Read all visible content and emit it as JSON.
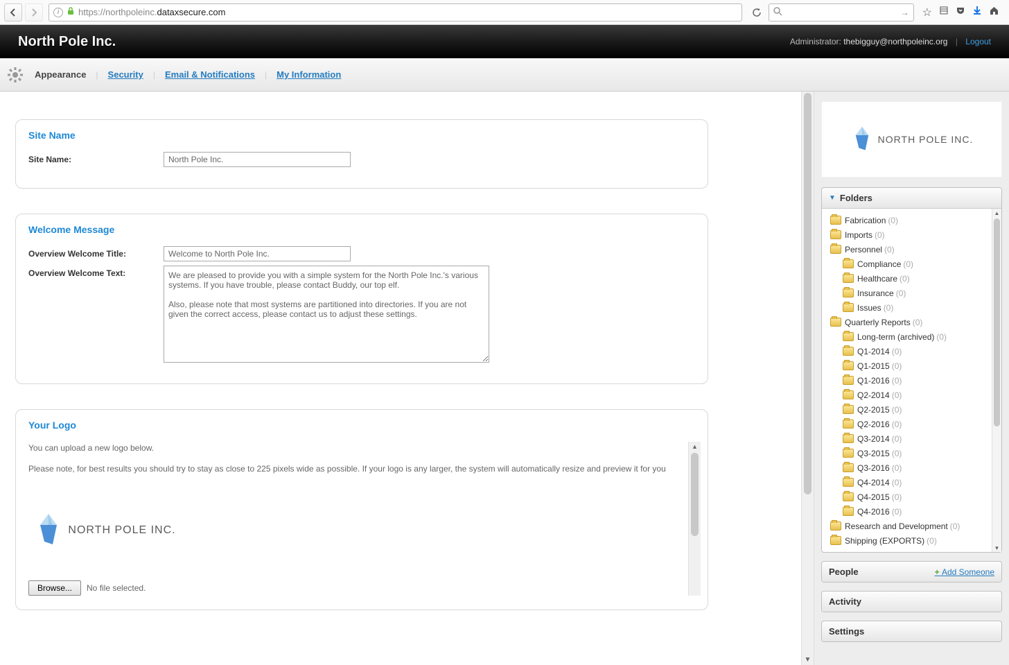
{
  "browser": {
    "url_prefix": "https://",
    "url_host": "northpoleinc.",
    "url_domain": "dataxsecure.com",
    "search_placeholder": ""
  },
  "header": {
    "site_title": "North Pole Inc.",
    "admin_label": "Administrator: ",
    "admin_email": "thebigguy@northpoleinc.org",
    "logout": "Logout"
  },
  "tabs": {
    "appearance": "Appearance",
    "security": "Security",
    "email": "Email & Notifications",
    "myinfo": "My Information"
  },
  "panels": {
    "site_name": {
      "title": "Site Name",
      "label": "Site Name:",
      "value": "North Pole Inc."
    },
    "welcome": {
      "title": "Welcome Message",
      "title_label": "Overview Welcome Title:",
      "title_value": "Welcome to North Pole Inc.",
      "text_label": "Overview Welcome Text:",
      "text_value": "We are pleased to provide you with a simple system for the North Pole Inc.'s various systems. If you have trouble, please contact Buddy, our top elf.\n\nAlso, please note that most systems are partitioned into directories. If you are not given the correct access, please contact us to adjust these settings."
    },
    "logo": {
      "title": "Your Logo",
      "intro": "You can upload a new logo below.",
      "note": "Please note, for best results you should try to stay as close to 225 pixels wide as possible. If your logo is any larger, the system will automatically resize and preview it for you",
      "browse": "Browse...",
      "no_file": "No file selected.",
      "logo_text": "NORTH POLE INC."
    }
  },
  "sidebar": {
    "folders_title": "Folders",
    "people_title": "People",
    "add_someone": "Add Someone",
    "activity_title": "Activity",
    "settings_title": "Settings",
    "logo_text": "NORTH POLE INC.",
    "folders": [
      {
        "depth": 0,
        "name": "Fabrication",
        "count": "(0)"
      },
      {
        "depth": 0,
        "name": "Imports",
        "count": "(0)"
      },
      {
        "depth": 0,
        "name": "Personnel",
        "count": "(0)"
      },
      {
        "depth": 1,
        "name": "Compliance",
        "count": "(0)"
      },
      {
        "depth": 1,
        "name": "Healthcare",
        "count": "(0)"
      },
      {
        "depth": 1,
        "name": "Insurance",
        "count": "(0)"
      },
      {
        "depth": 1,
        "name": "Issues",
        "count": "(0)"
      },
      {
        "depth": 0,
        "name": "Quarterly Reports",
        "count": "(0)"
      },
      {
        "depth": 1,
        "name": "Long-term (archived)",
        "count": "(0)"
      },
      {
        "depth": 1,
        "name": "Q1-2014",
        "count": "(0)"
      },
      {
        "depth": 1,
        "name": "Q1-2015",
        "count": "(0)"
      },
      {
        "depth": 1,
        "name": "Q1-2016",
        "count": "(0)"
      },
      {
        "depth": 1,
        "name": "Q2-2014",
        "count": "(0)"
      },
      {
        "depth": 1,
        "name": "Q2-2015",
        "count": "(0)"
      },
      {
        "depth": 1,
        "name": "Q2-2016",
        "count": "(0)"
      },
      {
        "depth": 1,
        "name": "Q3-2014",
        "count": "(0)"
      },
      {
        "depth": 1,
        "name": "Q3-2015",
        "count": "(0)"
      },
      {
        "depth": 1,
        "name": "Q3-2016",
        "count": "(0)"
      },
      {
        "depth": 1,
        "name": "Q4-2014",
        "count": "(0)"
      },
      {
        "depth": 1,
        "name": "Q4-2015",
        "count": "(0)"
      },
      {
        "depth": 1,
        "name": "Q4-2016",
        "count": "(0)"
      },
      {
        "depth": 0,
        "name": "Research and Development",
        "count": "(0)"
      },
      {
        "depth": 0,
        "name": "Shipping (EXPORTS)",
        "count": "(0)"
      }
    ]
  }
}
